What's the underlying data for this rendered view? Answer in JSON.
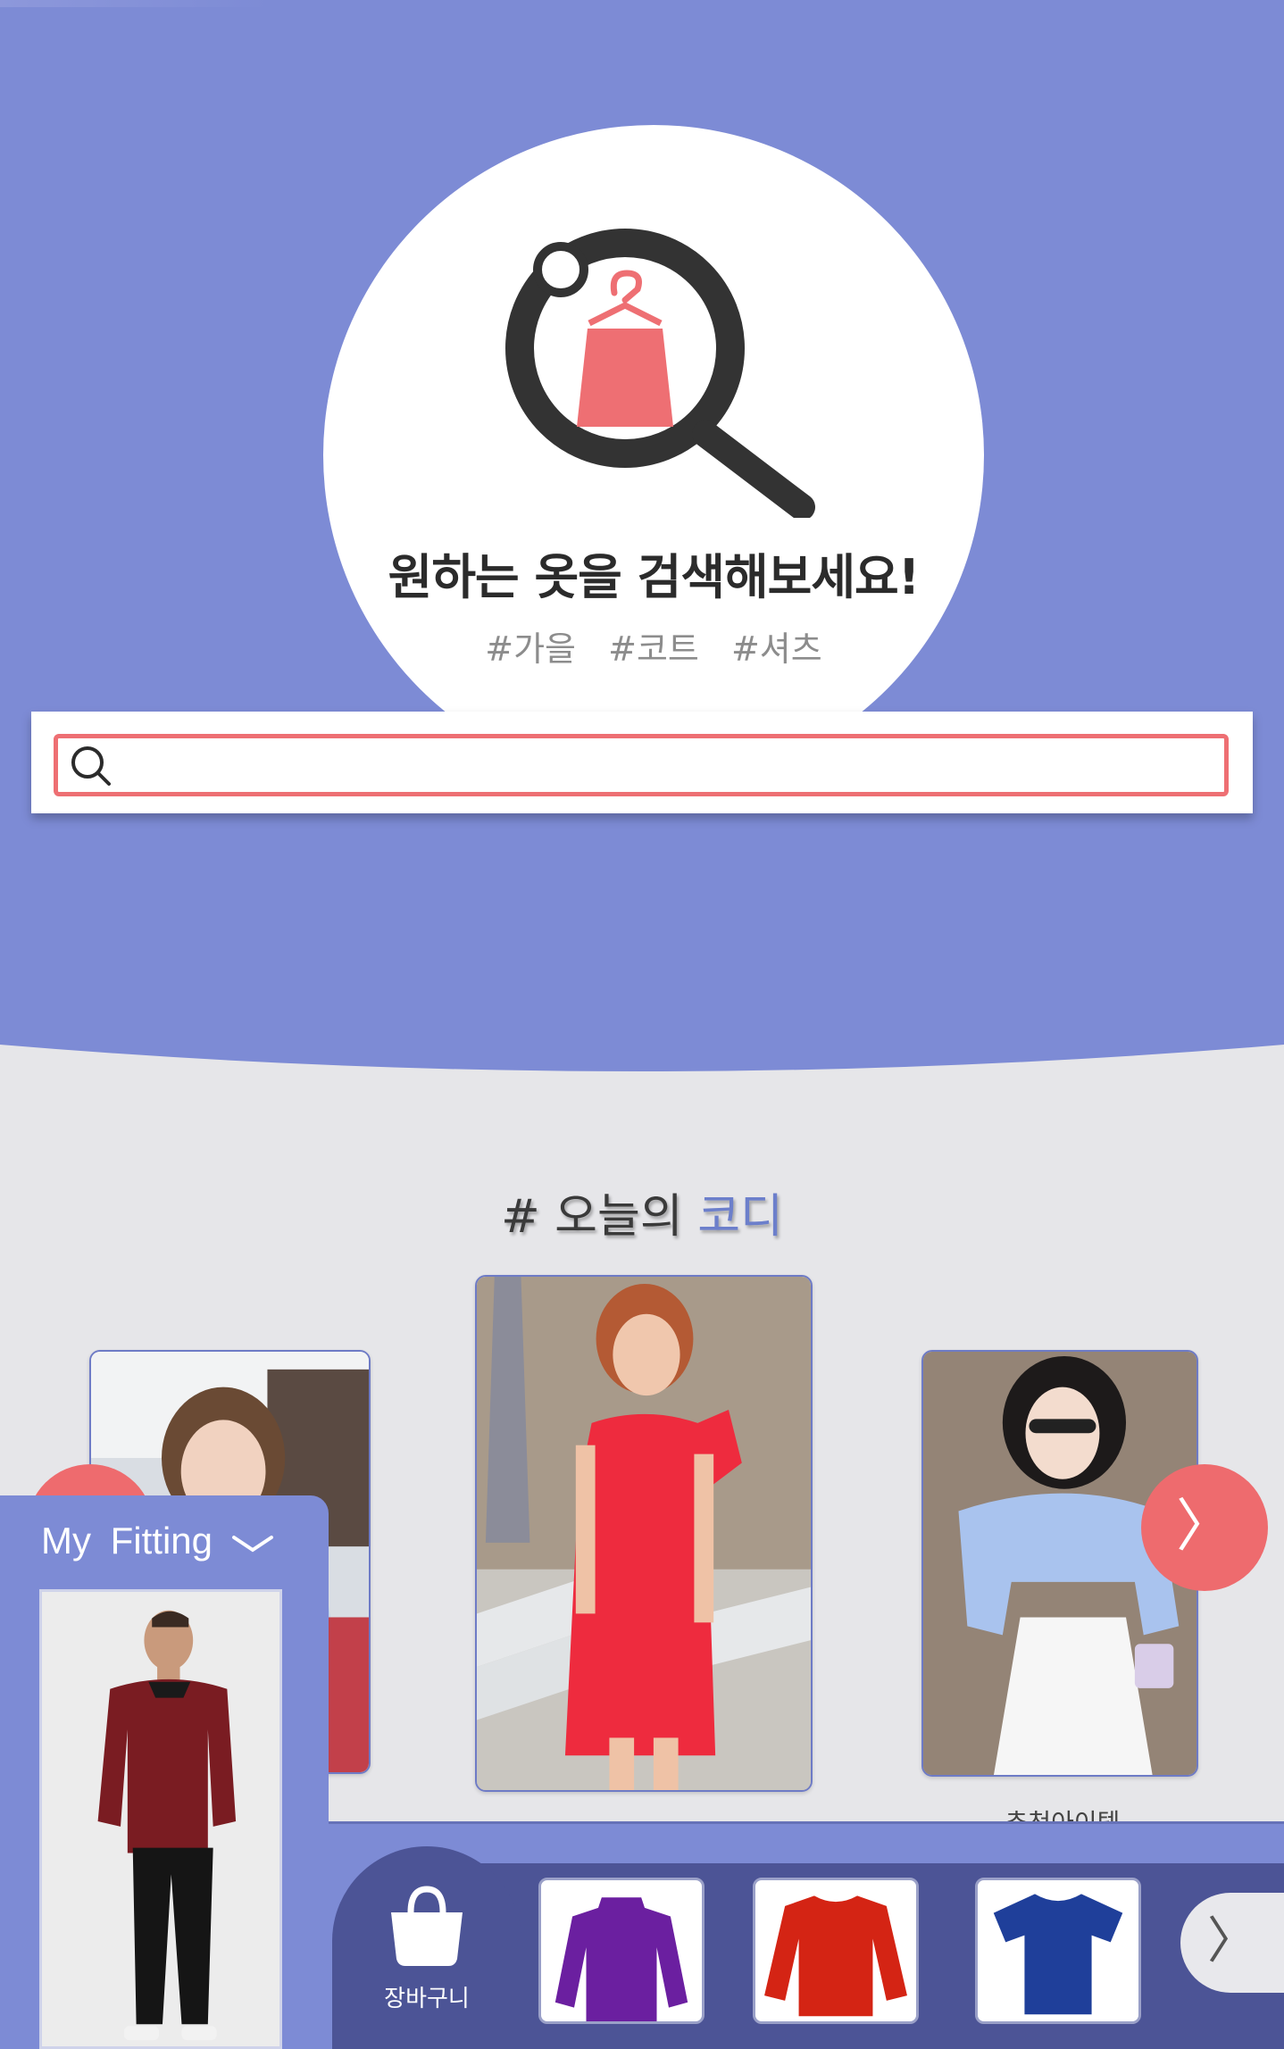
{
  "hero": {
    "title": "원하는 옷을 검색해보세요!",
    "tags": [
      "#가을",
      "#코트",
      "#셔츠"
    ],
    "logo_icon": "magnifier-hanger-bag-icon"
  },
  "search": {
    "value": "",
    "placeholder": "",
    "icon": "search-icon"
  },
  "codi": {
    "title_prefix": "# 오늘의 ",
    "title_accent": "코디",
    "prev_label": "〈",
    "next_label": "〉",
    "recommend_label": "추천아이템"
  },
  "fitting": {
    "title": "My  Fitting",
    "toggle_icon": "chevron-down-icon"
  },
  "cart": {
    "label": "장바구니",
    "icon": "shopping-bag-icon"
  },
  "items": {
    "next_label": "〉",
    "colors": [
      "#6b1fa0",
      "#d42414",
      "#1f3f9a"
    ]
  },
  "colors": {
    "background": "#7d8bd5",
    "accent": "#ee6b6e",
    "panel": "#e6e6e9",
    "dark_strip": "#4c5496"
  }
}
